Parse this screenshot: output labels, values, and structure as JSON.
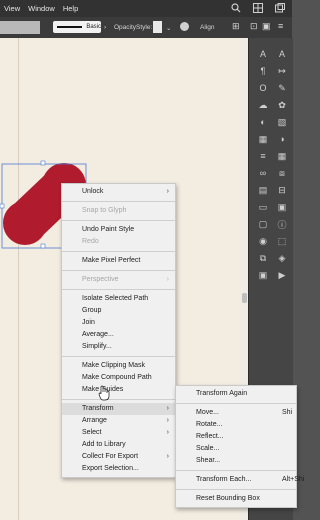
{
  "menubar": {
    "items": [
      "View",
      "Window",
      "Help"
    ]
  },
  "optionsbar": {
    "stroke_style_label": "Basic",
    "opacity_label": "Opacity",
    "style_label": "Style:",
    "align_label": "Align"
  },
  "shape_color": "#b01c2e",
  "context_menu": {
    "items": [
      {
        "label": "Unlock",
        "submenu": true
      },
      {
        "sep": true
      },
      {
        "label": "Snap to Glyph",
        "disabled": true
      },
      {
        "sep": true
      },
      {
        "label": "Undo Paint Style"
      },
      {
        "label": "Redo",
        "disabled": true
      },
      {
        "sep": true
      },
      {
        "label": "Make Pixel Perfect"
      },
      {
        "sep": true
      },
      {
        "label": "Perspective",
        "submenu": true,
        "disabled": true
      },
      {
        "sep": true
      },
      {
        "label": "Isolate Selected Path"
      },
      {
        "label": "Group"
      },
      {
        "label": "Join"
      },
      {
        "label": "Average..."
      },
      {
        "label": "Simplify..."
      },
      {
        "sep": true
      },
      {
        "label": "Make Clipping Mask"
      },
      {
        "label": "Make Compound Path"
      },
      {
        "label": "Make Guides"
      },
      {
        "sep": true
      },
      {
        "label": "Transform",
        "submenu": true,
        "highlight": true
      },
      {
        "label": "Arrange",
        "submenu": true
      },
      {
        "label": "Select",
        "submenu": true
      },
      {
        "label": "Add to Library"
      },
      {
        "label": "Collect For Export",
        "submenu": true
      },
      {
        "label": "Export Selection..."
      }
    ]
  },
  "transform_submenu": {
    "items": [
      {
        "label": "Transform Again"
      },
      {
        "sep": true
      },
      {
        "label": "Move...",
        "shortcut": "Shi"
      },
      {
        "label": "Rotate..."
      },
      {
        "label": "Reflect..."
      },
      {
        "label": "Scale..."
      },
      {
        "label": "Shear..."
      },
      {
        "sep": true
      },
      {
        "label": "Transform Each...",
        "shortcut": "Alt+Shi"
      },
      {
        "sep": true
      },
      {
        "label": "Reset Bounding Box"
      }
    ]
  }
}
